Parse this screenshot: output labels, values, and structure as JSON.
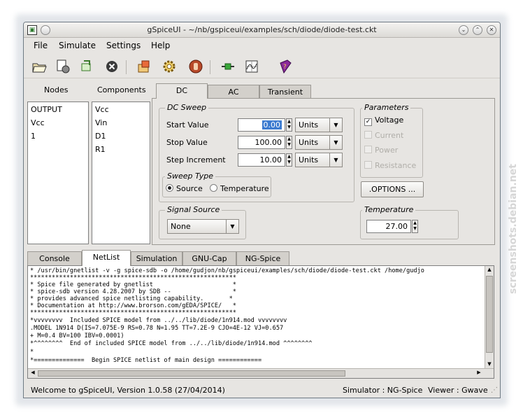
{
  "window": {
    "title": "gSpiceUI  -  ~/nb/gspiceui/examples/sch/diode/diode-test.ckt"
  },
  "menu": {
    "items": [
      {
        "label": "File"
      },
      {
        "label": "Simulate"
      },
      {
        "label": "Settings"
      },
      {
        "label": "Help"
      }
    ]
  },
  "toolbar": {
    "icons": [
      "open-folder-icon",
      "open-file-icon",
      "import-icon",
      "close-circle-icon",
      "build-icon",
      "gear-icon",
      "stop-hand-icon",
      "connector-icon",
      "wave-viewer-icon",
      "help-book-icon"
    ]
  },
  "left_panel": {
    "nodes_label": "Nodes",
    "components_label": "Components",
    "nodes": [
      "OUTPUT",
      "Vcc",
      "1"
    ],
    "components": [
      "Vcc",
      "Vin",
      "D1",
      "R1"
    ]
  },
  "analysis_tabs": [
    {
      "label": "DC"
    },
    {
      "label": "AC"
    },
    {
      "label": "Transient"
    }
  ],
  "dc_sweep": {
    "title": "DC Sweep",
    "start_label": "Start Value",
    "start_value": "0.00",
    "start_units": "Units",
    "stop_label": "Stop Value",
    "stop_value": "100.00",
    "stop_units": "Units",
    "step_label": "Step Increment",
    "step_value": "10.00",
    "step_units": "Units",
    "sweep_type_title": "Sweep Type",
    "sweep_source": "Source",
    "sweep_temperature": "Temperature"
  },
  "parameters": {
    "title": "Parameters",
    "voltage": "Voltage",
    "current": "Current",
    "power": "Power",
    "resistance": "Resistance",
    "options_button": ".OPTIONS ..."
  },
  "signal_source": {
    "title": "Signal Source",
    "value": "None"
  },
  "temperature": {
    "title": "Temperature",
    "value": "27.00"
  },
  "output_tabs": [
    {
      "label": "Console"
    },
    {
      "label": "NetList"
    },
    {
      "label": "Simulation"
    },
    {
      "label": "GNU-Cap"
    },
    {
      "label": "NG-Spice"
    }
  ],
  "netlist_lines": [
    "* /usr/bin/gnetlist -v -g spice-sdb -o /home/gudjon/nb/gspiceui/examples/sch/diode/diode-test.ckt /home/gudjo",
    "*********************************************************",
    "* Spice file generated by gnetlist                      *",
    "* spice-sdb version 4.28.2007 by SDB --                 *",
    "* provides advanced spice netlisting capability.       *",
    "* Documentation at http://www.brorson.com/gEDA/SPICE/   *",
    "*********************************************************",
    "*vvvvvvvv  Included SPICE model from ../../lib/diode/1n914.mod vvvvvvvv",
    ".MODEL 1N914 D(IS=7.075E-9 RS=0.78 N=1.95 TT=7.2E-9 CJO=4E-12 VJ=0.657",
    "+ M=0.4 BV=100 IBV=0.0001)",
    "*^^^^^^^^  End of included SPICE model from ../../lib/diode/1n914.mod ^^^^^^^^",
    "*",
    "*==============  Begin SPICE netlist of main design ============"
  ],
  "status": {
    "message": "Welcome to gSpiceUI, Version 1.0.58 (27/04/2014)",
    "simulator": "Simulator : NG-Spice",
    "viewer": "Viewer : Gwave"
  },
  "watermark": "screenshots.debian.net"
}
